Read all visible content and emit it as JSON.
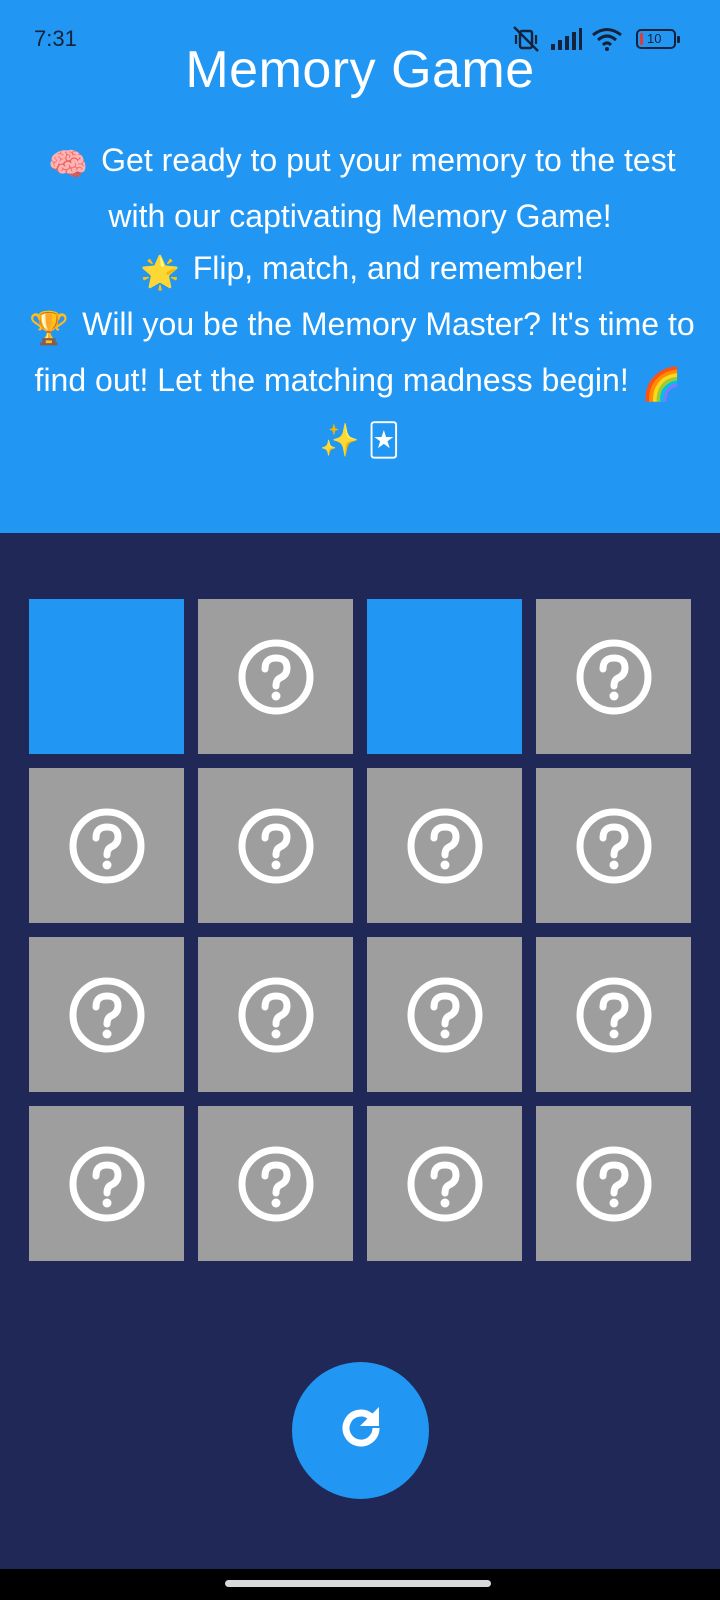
{
  "status_bar": {
    "time": "7:31",
    "battery_level": "10",
    "icons": [
      "vibrate-off-icon",
      "signal-icon",
      "wifi-icon",
      "battery-icon"
    ]
  },
  "app": {
    "title": "Memory Game",
    "intro": {
      "line1": {
        "emoji": "🧠",
        "text": "Get ready to put your memory to the test with our captivating Memory Game!"
      },
      "line2": {
        "emoji": "🌟",
        "text": "Flip, match, and remember!"
      },
      "line3": {
        "emoji": "🏆",
        "text": "Will you be the Memory Master? It's time to find out! Let the matching madness begin!",
        "trailing_emojis": [
          "🌈",
          "✨",
          "🃏"
        ]
      }
    }
  },
  "board": {
    "columns": 4,
    "rows": 4,
    "cards": [
      {
        "state": "flipped"
      },
      {
        "state": "hidden"
      },
      {
        "state": "flipped"
      },
      {
        "state": "hidden"
      },
      {
        "state": "hidden"
      },
      {
        "state": "hidden"
      },
      {
        "state": "hidden"
      },
      {
        "state": "hidden"
      },
      {
        "state": "hidden"
      },
      {
        "state": "hidden"
      },
      {
        "state": "hidden"
      },
      {
        "state": "hidden"
      },
      {
        "state": "hidden"
      },
      {
        "state": "hidden"
      },
      {
        "state": "hidden"
      },
      {
        "state": "hidden"
      }
    ],
    "hidden_icon": "question-mark-icon"
  },
  "actions": {
    "restart_icon": "refresh-icon"
  },
  "colors": {
    "header": "#2196f3",
    "background": "#1f2857",
    "card_hidden": "#9e9e9e",
    "card_flipped": "#2196f3",
    "button": "#2196f3"
  }
}
